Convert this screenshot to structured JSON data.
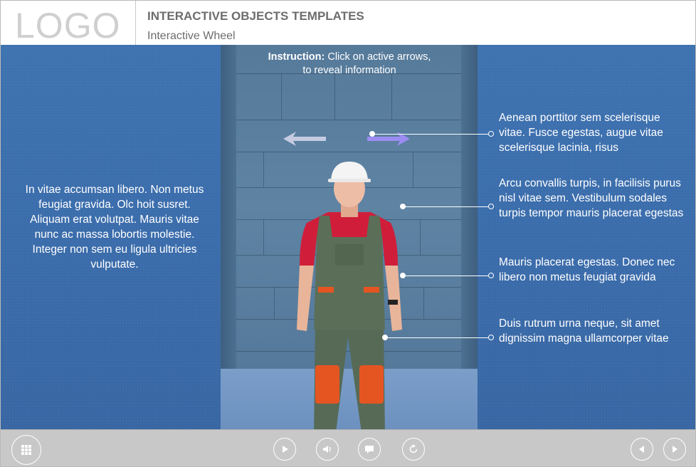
{
  "header": {
    "logo": "LOGO",
    "title": "INTERACTIVE OBJECTS TEMPLATES",
    "subtitle": "Interactive Wheel"
  },
  "instruction": {
    "label": "Instruction:",
    "text": " Click on active arrows,",
    "text2": "to reveal information"
  },
  "left_text": "In vitae accumsan libero. Non metus feugiat gravida. Olc hoit susret. Aliquam erat volutpat. Mauris vitae nunc ac massa lobortis molestie. Integer non sem eu ligula ultricies vulputate.",
  "info_items": [
    {
      "text": "Aenean porttitor sem scelerisque vitae. Fusce egestas, augue vitae scelerisque lacinia, risus"
    },
    {
      "text": "Arcu convallis turpis, in facilisis purus nisl vitae sem. Vestibulum sodales turpis tempor mauris placerat egestas"
    },
    {
      "text": "Mauris placerat egestas. Donec nec libero non metus feugiat gravida"
    },
    {
      "text": "Duis rutrum urna neque, sit amet dignissim magna ullamcorper vitae"
    }
  ],
  "colors": {
    "main_blue": "#3a6cab",
    "arrow_left": "#c5cbe0",
    "arrow_right": "#9c8cf2",
    "footer": "#c8c8c8"
  },
  "icons": {
    "menu": "grid-icon",
    "play": "play-icon",
    "audio": "speaker-icon",
    "captions": "speech-bubble-icon",
    "replay": "replay-icon",
    "prev": "prev-icon",
    "next": "next-icon"
  }
}
